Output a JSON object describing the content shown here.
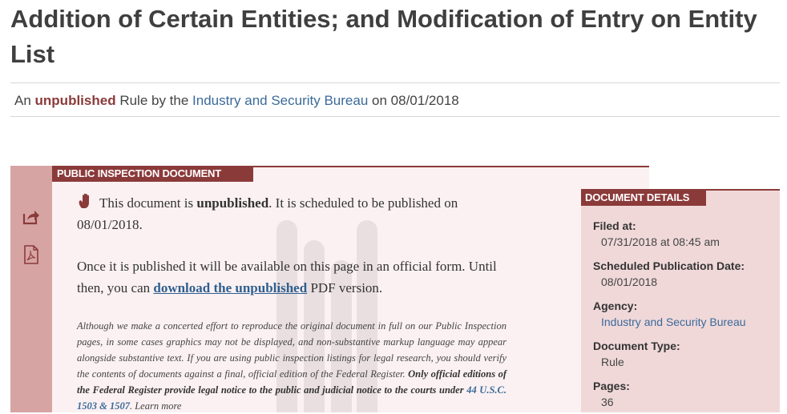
{
  "header": {
    "title": "Addition of Certain Entities; and Modification of Entry on Entity List",
    "byline": {
      "prefix": "An",
      "status": "unpublished",
      "middle": "Rule by the",
      "agency": "Industry and Security Bureau",
      "on": "on",
      "date": "08/01/2018"
    }
  },
  "rail": {
    "icons": [
      "share-icon",
      "pdf-icon"
    ]
  },
  "inspection": {
    "header": "PUBLIC INSPECTION DOCUMENT",
    "p1_prefix": "This document is",
    "p1_bold": "unpublished",
    "p1_suffix": ". It is scheduled to be published on 08/01/2018.",
    "p2_prefix": "Once it is published it will be available on this page in an official form. Until then, you can",
    "p2_link": "download the unpublished",
    "p2_suffix": "PDF version.",
    "disclaimer_italic": "Although we make a concerted effort to reproduce the original document in full on our Public Inspection pages, in some cases graphics may not be displayed, and non-substantive markup language may appear alongside substantive text. If you are using public inspection listings for legal research, you should verify the contents of documents against a final, official edition of the Federal Register.",
    "disclaimer_bold": "Only official editions of the Federal Register provide legal notice to the public and judicial notice to the courts under",
    "disclaimer_link": "44 U.S.C. 1503 & 1507",
    "disclaimer_tail": ". Learn more"
  },
  "details": {
    "header": "DOCUMENT DETAILS",
    "filed_label": "Filed at:",
    "filed_value": "07/31/2018 at 08:45 am",
    "pubdate_label": "Scheduled Publication Date:",
    "pubdate_value": "08/01/2018",
    "agency_label": "Agency:",
    "agency_value": "Industry and Security Bureau",
    "type_label": "Document Type:",
    "type_value": "Rule",
    "pages_label": "Pages:",
    "pages_value": "36"
  },
  "colors": {
    "accent": "#8b3a3a",
    "link": "#3b6a9a",
    "rail": "#d7a4a4",
    "panel": "#fbf1f2",
    "details_panel": "#f0d8d9"
  }
}
